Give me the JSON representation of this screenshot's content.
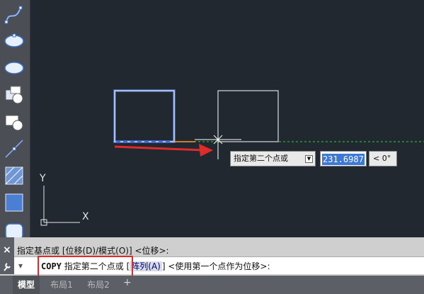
{
  "toolbar": {
    "tools": [
      "spline-icon",
      "ellipse-icon",
      "ellipse-arc-icon",
      "insert-block-icon",
      "make-block-icon",
      "point-icon",
      "hatch-icon",
      "gradient-icon",
      "region-icon"
    ]
  },
  "canvas": {
    "ucs": {
      "y_label": "Y",
      "x_label": "X"
    }
  },
  "dynamic_input": {
    "prompt": "指定第二个点或",
    "distance": "231.6987",
    "angle": "< 0°"
  },
  "command": {
    "history": "指定基点或 [位移(D)/模式(O)] <位移>:",
    "current_command": "COPY",
    "current_prompt": "指定第二个点或",
    "open_bracket": "[",
    "option": "阵列(A)",
    "close_rest": "] <使用第一个点作为位移>:",
    "close_icon": "×",
    "settings_icon": "wrench"
  },
  "tabs": [
    {
      "label": "模型"
    },
    {
      "label": "布局1"
    },
    {
      "label": "布局2"
    }
  ],
  "colors": {
    "background": "#212830",
    "selected_rect": "#a8c8ff",
    "copy_rect": "#ffffff",
    "annotation_red": "#e02b2b",
    "tracking_line": "#3fc93f"
  }
}
